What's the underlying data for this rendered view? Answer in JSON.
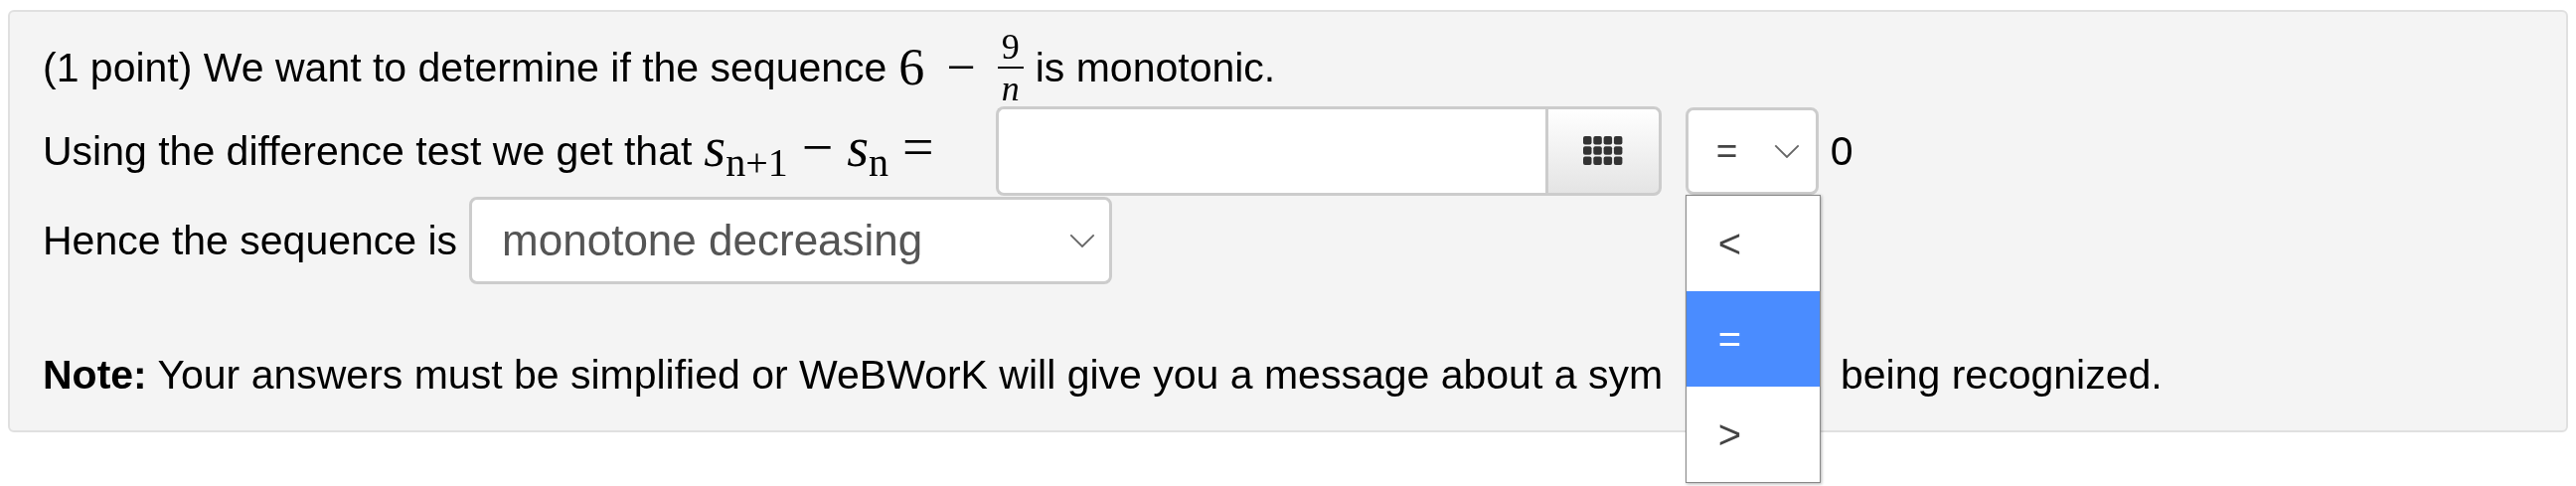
{
  "problem": {
    "points": "(1 point)",
    "intro": "We want to determine if the sequence",
    "sequence": {
      "whole": "6",
      "op": "−",
      "numerator": "9",
      "denominator": "n"
    },
    "intro_end": "is monotonic."
  },
  "difference": {
    "label": "Using the difference test we get that",
    "expression": "*s*$_{n+1}$ − *s*$_{n}$ =",
    "relation": {
      "value": "=",
      "expanded": true,
      "options": [
        {
          "label": "<",
          "selected": false
        },
        {
          "label": "=",
          "selected": true
        },
        {
          "label": ">",
          "selected": false
        }
      ]
    },
    "rhs": "0"
  },
  "conclusion": {
    "label": "Hence the sequence is",
    "select": {
      "value": "monotone decreasing"
    }
  },
  "note": {
    "label": "Note:",
    "text_before": "Your answers must be simplified or WeBWorK will give you a message about a sym",
    "text_after": "being recognized."
  }
}
